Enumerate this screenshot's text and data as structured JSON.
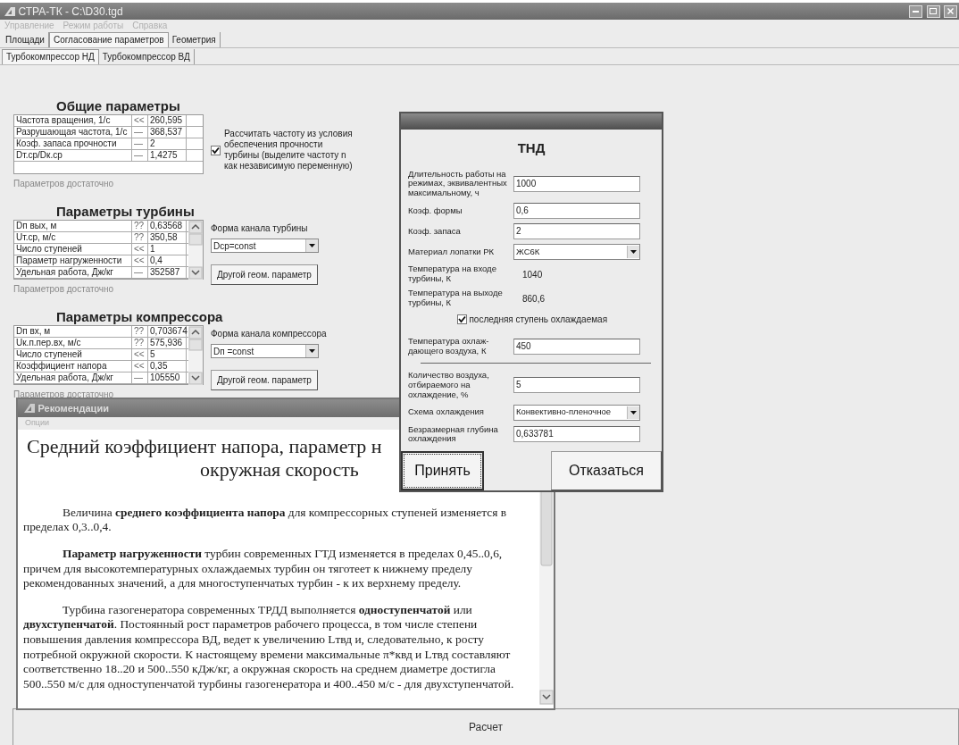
{
  "window": {
    "title": "СТРА-ТК - C:\\D30.tgd"
  },
  "menu": [
    "Управление",
    "Режим работы",
    "Справка"
  ],
  "tabs": [
    {
      "label": "Площади",
      "selected": false
    },
    {
      "label": "Согласование параметров",
      "selected": true
    },
    {
      "label": "Геометрия",
      "selected": false
    }
  ],
  "subtabs": [
    {
      "label": "Турбокомпрессор НД",
      "selected": true
    },
    {
      "label": "Турбокомпрессор ВД",
      "selected": false
    }
  ],
  "sections": [
    {
      "title": "Общие параметры",
      "scrollbar": false,
      "rows": [
        {
          "name": "Частота вращения, 1/с",
          "mark": "<<",
          "value": "260,595"
        },
        {
          "name": "Разрушающая частота, 1/с",
          "mark": "—",
          "value": "368,537"
        },
        {
          "name": "Коэф. запаса прочности",
          "mark": "—",
          "value": "2"
        },
        {
          "name": "Dт.ср/Dк.ср",
          "mark": "—",
          "value": "1,4275"
        }
      ],
      "status": "Параметров достаточно",
      "side": {
        "kind": "checkbox",
        "checked": true,
        "label": "Рассчитать частоту из условия обеспечения прочности турбины (выделите частоту n как независимую переменную)"
      }
    },
    {
      "title": "Параметры турбины",
      "scrollbar": true,
      "rows": [
        {
          "name": "Dп вых, м",
          "mark": "??",
          "value": "0,63568"
        },
        {
          "name": "Uт.ср, м/с",
          "mark": "??",
          "value": "350,58"
        },
        {
          "name": "Число ступеней",
          "mark": "<<",
          "value": "1"
        },
        {
          "name": "Параметр нагруженности",
          "mark": "<<",
          "value": "0,4"
        },
        {
          "name": "Удельная работа, Дж/кг",
          "mark": "—",
          "value": "352587"
        }
      ],
      "status": "Параметров достаточно",
      "side": {
        "kind": "shape",
        "label": "Форма канала турбины",
        "value": "Dcp=const",
        "button": "Другой геом. параметр"
      }
    },
    {
      "title": "Параметры компрессора",
      "scrollbar": true,
      "rows": [
        {
          "name": "Dп вх, м",
          "mark": "??",
          "value": "0,703674"
        },
        {
          "name": "Uк.п.пер.вх, м/с",
          "mark": "??",
          "value": "575,936"
        },
        {
          "name": "Число ступеней",
          "mark": "<<",
          "value": "5"
        },
        {
          "name": "Коэффициент напора",
          "mark": "<<",
          "value": "0,35"
        },
        {
          "name": "Удельная работа, Дж/кг",
          "mark": "—",
          "value": "105550"
        }
      ],
      "status": "Параметров достаточно",
      "side": {
        "kind": "shape",
        "label": "Форма канала компрессора",
        "value": "Dп =const",
        "button": "Другой геом. параметр"
      }
    }
  ],
  "recommendations": {
    "title": "Рекомендации",
    "menu": [
      "Опции"
    ],
    "heading": [
      "Средний коэффициент напора, параметр н",
      "окружная скорость"
    ],
    "paragraphs": [
      "Величина **среднего коэффициента напора** для компрессорных ступеней изменяется в пределах 0,3..0,4.",
      "**Параметр нагруженности** турбин современных ГТД изменяется в пределах 0,45..0,6, причем для высокотемпературных охлаждаемых турбин он тяготеет к нижнему пределу рекомендованных значений, а для многоступенчатых турбин - к их верхнему пределу.",
      "Турбина газогенератора современных ТРДД выполняется **одноступенчатой** или **двухступенчатой**. Постоянный рост параметров рабочего процесса, в том числе степени повышения давления компрессора ВД, ведет к увеличению Lтвд и, следовательно, к росту потребной окружной скорости. К настоящему времени максимальные π*квд и Lтвд составляют соответственно 18..20 и 500..550 кДж/кг, а окружная скорость на среднем диаметре достигла 500..550 м/с для одноступенчатой турбины газогенератора и 400..450 м/с - для двухступенчатой."
    ]
  },
  "dialog": {
    "heading": "ТНД",
    "fields": [
      {
        "kind": "input",
        "label": "Длительность работы на режимах, эквивалентных максимальному, ч",
        "value": "1000"
      },
      {
        "kind": "input",
        "label": "Коэф. формы",
        "value": "0,6"
      },
      {
        "kind": "input",
        "label": "Коэф. запаса",
        "value": "2"
      },
      {
        "kind": "select",
        "label": "Материал лопатки РК",
        "value": "ЖС6К"
      },
      {
        "kind": "readout",
        "label": "Температура на входе турбины, К",
        "value": "1040"
      },
      {
        "kind": "readout",
        "label": "Температура на выходе турбины, К",
        "value": "860,6"
      },
      {
        "kind": "checkbox",
        "label": "последняя ступень охлаждаемая",
        "checked": true
      },
      {
        "kind": "input",
        "label": "Температура охлаж- дающего воздуха, К",
        "value": "450"
      },
      {
        "kind": "divider"
      },
      {
        "kind": "input",
        "label": "Количество воздуха, отбираемого на охлаждение, %",
        "value": "5"
      },
      {
        "kind": "select",
        "label": "Схема охлаждения",
        "value": "Конвективно-пленочное"
      },
      {
        "kind": "input",
        "label": "Безразмерная глубина охлаждения",
        "value": "0,633781"
      }
    ],
    "buttons": [
      {
        "label": "Принять",
        "focused": true
      },
      {
        "label": "Отказаться",
        "focused": false
      }
    ]
  },
  "calc_button": "Расчет"
}
